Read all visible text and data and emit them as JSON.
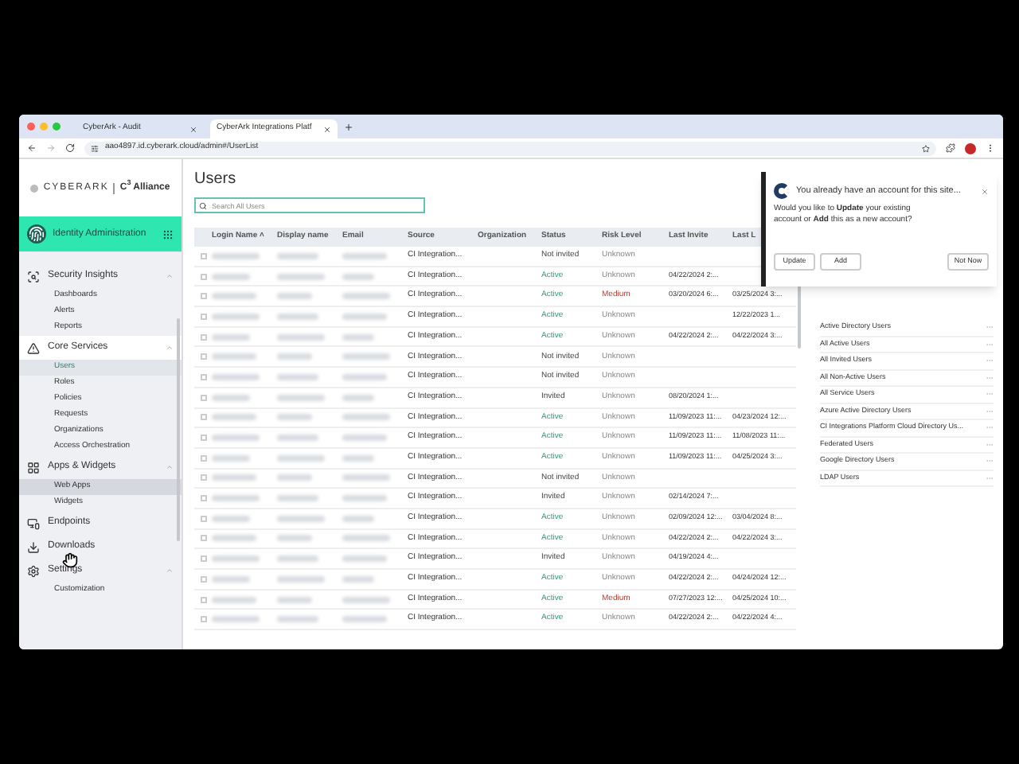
{
  "browser": {
    "tabs": [
      {
        "title": "CyberArk - Audit",
        "selected": false
      },
      {
        "title": "CyberArk Integrations Platf",
        "selected": true
      }
    ],
    "url": "aao4897.id.cyberark.cloud/admin#/UserList"
  },
  "sidebar": {
    "brand": "CYBERARK",
    "alliance": "C$^{3}$ Alliance",
    "app_title": "Identity Administration",
    "sections": [
      {
        "label": "Security Insights",
        "expanded": true,
        "selected": false,
        "children": [
          {
            "label": "Dashboards",
            "selected": false,
            "hovered": false
          },
          {
            "label": "Alerts",
            "selected": false,
            "hovered": false
          },
          {
            "label": "Reports",
            "selected": false,
            "hovered": false
          }
        ]
      },
      {
        "label": "Core Services",
        "expanded": true,
        "selected": true,
        "children": [
          {
            "label": "Users",
            "selected": true,
            "hovered": false
          },
          {
            "label": "Roles",
            "selected": false,
            "hovered": false
          },
          {
            "label": "Policies",
            "selected": false,
            "hovered": false
          },
          {
            "label": "Requests",
            "selected": false,
            "hovered": false
          },
          {
            "label": "Organizations",
            "selected": false,
            "hovered": false
          },
          {
            "label": "Access Orchestration",
            "selected": false,
            "hovered": false
          }
        ]
      },
      {
        "label": "Apps & Widgets",
        "expanded": true,
        "selected": false,
        "children": [
          {
            "label": "Web Apps",
            "selected": false,
            "hovered": true
          },
          {
            "label": "Widgets",
            "selected": false,
            "hovered": false
          }
        ]
      },
      {
        "label": "Endpoints",
        "selected": false
      },
      {
        "label": "Downloads",
        "selected": false
      },
      {
        "label": "Settings",
        "expanded": true,
        "selected": false,
        "children": [
          {
            "label": "Customization",
            "selected": false,
            "hovered": false
          }
        ]
      }
    ]
  },
  "page": {
    "title": "Users",
    "search": {
      "placeholder": "Search All Users"
    }
  },
  "table": {
    "columns": [
      "Login Name ˄",
      "Display name",
      "Email",
      "Source",
      "Organization",
      "Status",
      "Risk Level",
      "Last Invite",
      "Last L"
    ],
    "rows": [
      {
        "checked": false,
        "source": "CI Integration...",
        "status": {
          "text": "Not invited",
          "kind": "neutral"
        },
        "risk": {
          "text": "Unknown",
          "kind": "unknown"
        },
        "last_invite": "",
        "last_login": ""
      },
      {
        "checked": false,
        "source": "CI Integration...",
        "status": {
          "text": "Active",
          "kind": "active"
        },
        "risk": {
          "text": "Unknown",
          "kind": "unknown"
        },
        "last_invite": "04/22/2024 2:...",
        "last_login": ""
      },
      {
        "checked": false,
        "source": "CI Integration...",
        "status": {
          "text": "Active",
          "kind": "active"
        },
        "risk": {
          "text": "Medium",
          "kind": "medium"
        },
        "last_invite": "03/20/2024 6:...",
        "last_login": "03/25/2024 3:..."
      },
      {
        "checked": false,
        "source": "CI Integration...",
        "status": {
          "text": "Active",
          "kind": "active"
        },
        "risk": {
          "text": "Unknown",
          "kind": "unknown"
        },
        "last_invite": "",
        "last_login": "12/22/2023 1..."
      },
      {
        "checked": false,
        "source": "CI Integration...",
        "status": {
          "text": "Active",
          "kind": "active"
        },
        "risk": {
          "text": "Unknown",
          "kind": "unknown"
        },
        "last_invite": "04/22/2024 2:...",
        "last_login": "04/22/2024 3:..."
      },
      {
        "checked": false,
        "source": "CI Integration...",
        "status": {
          "text": "Not invited",
          "kind": "neutral"
        },
        "risk": {
          "text": "Unknown",
          "kind": "unknown"
        },
        "last_invite": "",
        "last_login": ""
      },
      {
        "checked": false,
        "source": "CI Integration...",
        "status": {
          "text": "Not invited",
          "kind": "neutral"
        },
        "risk": {
          "text": "Unknown",
          "kind": "unknown"
        },
        "last_invite": "",
        "last_login": ""
      },
      {
        "checked": false,
        "source": "CI Integration...",
        "status": {
          "text": "Invited",
          "kind": "neutral"
        },
        "risk": {
          "text": "Unknown",
          "kind": "unknown"
        },
        "last_invite": "08/20/2024 1:...",
        "last_login": ""
      },
      {
        "checked": false,
        "source": "CI Integration...",
        "status": {
          "text": "Active",
          "kind": "active"
        },
        "risk": {
          "text": "Unknown",
          "kind": "unknown"
        },
        "last_invite": "11/09/2023 11:...",
        "last_login": "04/23/2024 12:..."
      },
      {
        "checked": false,
        "source": "CI Integration...",
        "status": {
          "text": "Active",
          "kind": "active"
        },
        "risk": {
          "text": "Unknown",
          "kind": "unknown"
        },
        "last_invite": "11/09/2023 11:...",
        "last_login": "11/08/2023 11:..."
      },
      {
        "checked": false,
        "source": "CI Integration...",
        "status": {
          "text": "Active",
          "kind": "active"
        },
        "risk": {
          "text": "Unknown",
          "kind": "unknown"
        },
        "last_invite": "11/09/2023 11:...",
        "last_login": "04/25/2024 3:..."
      },
      {
        "checked": false,
        "source": "CI Integration...",
        "status": {
          "text": "Not invited",
          "kind": "neutral"
        },
        "risk": {
          "text": "Unknown",
          "kind": "unknown"
        },
        "last_invite": "",
        "last_login": ""
      },
      {
        "checked": false,
        "source": "CI Integration...",
        "status": {
          "text": "Invited",
          "kind": "neutral"
        },
        "risk": {
          "text": "Unknown",
          "kind": "unknown"
        },
        "last_invite": "02/14/2024 7:...",
        "last_login": ""
      },
      {
        "checked": false,
        "source": "CI Integration...",
        "status": {
          "text": "Active",
          "kind": "active"
        },
        "risk": {
          "text": "Unknown",
          "kind": "unknown"
        },
        "last_invite": "02/09/2024 12:...",
        "last_login": "03/04/2024 8:..."
      },
      {
        "checked": false,
        "source": "CI Integration...",
        "status": {
          "text": "Active",
          "kind": "active"
        },
        "risk": {
          "text": "Unknown",
          "kind": "unknown"
        },
        "last_invite": "04/22/2024 2:...",
        "last_login": "04/22/2024 3:..."
      },
      {
        "checked": false,
        "source": "CI Integration...",
        "status": {
          "text": "Invited",
          "kind": "neutral"
        },
        "risk": {
          "text": "Unknown",
          "kind": "unknown"
        },
        "last_invite": "04/19/2024 4:...",
        "last_login": ""
      },
      {
        "checked": false,
        "source": "CI Integration...",
        "status": {
          "text": "Active",
          "kind": "active"
        },
        "risk": {
          "text": "Unknown",
          "kind": "unknown"
        },
        "last_invite": "04/22/2024 2:...",
        "last_login": "04/24/2024 12:..."
      },
      {
        "checked": false,
        "source": "CI Integration...",
        "status": {
          "text": "Active",
          "kind": "active"
        },
        "risk": {
          "text": "Medium",
          "kind": "medium"
        },
        "last_invite": "07/27/2023 12:...",
        "last_login": "04/25/2024 10:..."
      },
      {
        "checked": false,
        "source": "CI Integration...",
        "status": {
          "text": "Active",
          "kind": "active"
        },
        "risk": {
          "text": "Unknown",
          "kind": "unknown"
        },
        "last_invite": "04/22/2024 2:...",
        "last_login": "04/22/2024 4:..."
      }
    ]
  },
  "user_sets": [
    "Active Directory Users",
    "All Active Users",
    "All Invited Users",
    "All Non-Active Users",
    "All Service Users",
    "Azure Active Directory Users",
    "CI Integrations Platform Cloud Directory Us...",
    "Federated Users",
    "Google Directory Users",
    "LDAP Users"
  ],
  "dialog": {
    "heading": "You already have an account for this site...",
    "message": "Would you like to **Update** your existing account or **Add** this as a new account?",
    "buttons": [
      "Update",
      "Add",
      "Not Now"
    ]
  }
}
